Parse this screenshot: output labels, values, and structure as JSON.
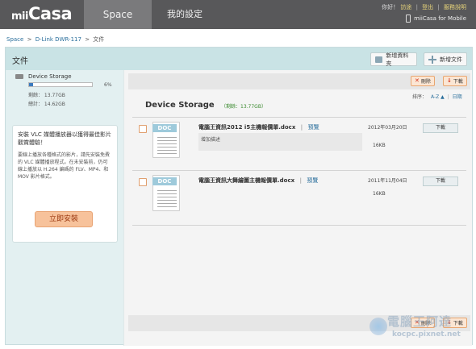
{
  "app": {
    "logo_mini": "mii",
    "logo_main": "Casa"
  },
  "tabs": {
    "space": "Space",
    "settings": "我的設定"
  },
  "top_links": {
    "hello": "你好！",
    "user": "訪途",
    "logout": "登出",
    "help": "服務說明",
    "mobile": "miiCasa for Mobile"
  },
  "breadcrumb": {
    "space": "Space",
    "device": "D-Link DWR-117",
    "current": "文件"
  },
  "panel": {
    "title": "文件",
    "new_folder": "新增資料夾",
    "new_file": "新增文件"
  },
  "storage": {
    "name": "Device Storage",
    "percent": "6%",
    "percent_value": 0.06,
    "free": "剩餘： 13.77GB",
    "total": "總計： 14.62GB"
  },
  "vlc": {
    "title": "安裝 VLC 媒體播放器以獲得最佳影片觀賞體驗！",
    "desc": "要線上播放各種格式的影片，請先安裝免費的 VLC 媒體播放程式。在未安裝前，仍可線上播放以 H.264 編碼的 FLV、MP4、和 MOV 影片格式。",
    "install": "立即安裝"
  },
  "toolbar": {
    "delete": "刪除",
    "download": "下載"
  },
  "sort": {
    "label": "排序：",
    "az": "A-Z ▲",
    "date": "日期"
  },
  "location": {
    "title": "Device Storage",
    "free": "（剩餘：13.77GB）"
  },
  "files": [
    {
      "name": "電腦王資訊2012 i5主機報價單.docx",
      "preview": "預覽",
      "desc": "增加描述",
      "date": "2012年03月20日",
      "size": "16KB",
      "download": "下載",
      "icon_label": "DOC"
    },
    {
      "name": "電腦王資訊大舞繪圖主機報價單.docx",
      "preview": "預覽",
      "desc": "",
      "date": "2011年11月04日",
      "size": "16KB",
      "download": "下載",
      "icon_label": "DOC"
    }
  ],
  "watermark": {
    "text": "電腦王阿達",
    "url": "kocpc.pixnet.net"
  }
}
